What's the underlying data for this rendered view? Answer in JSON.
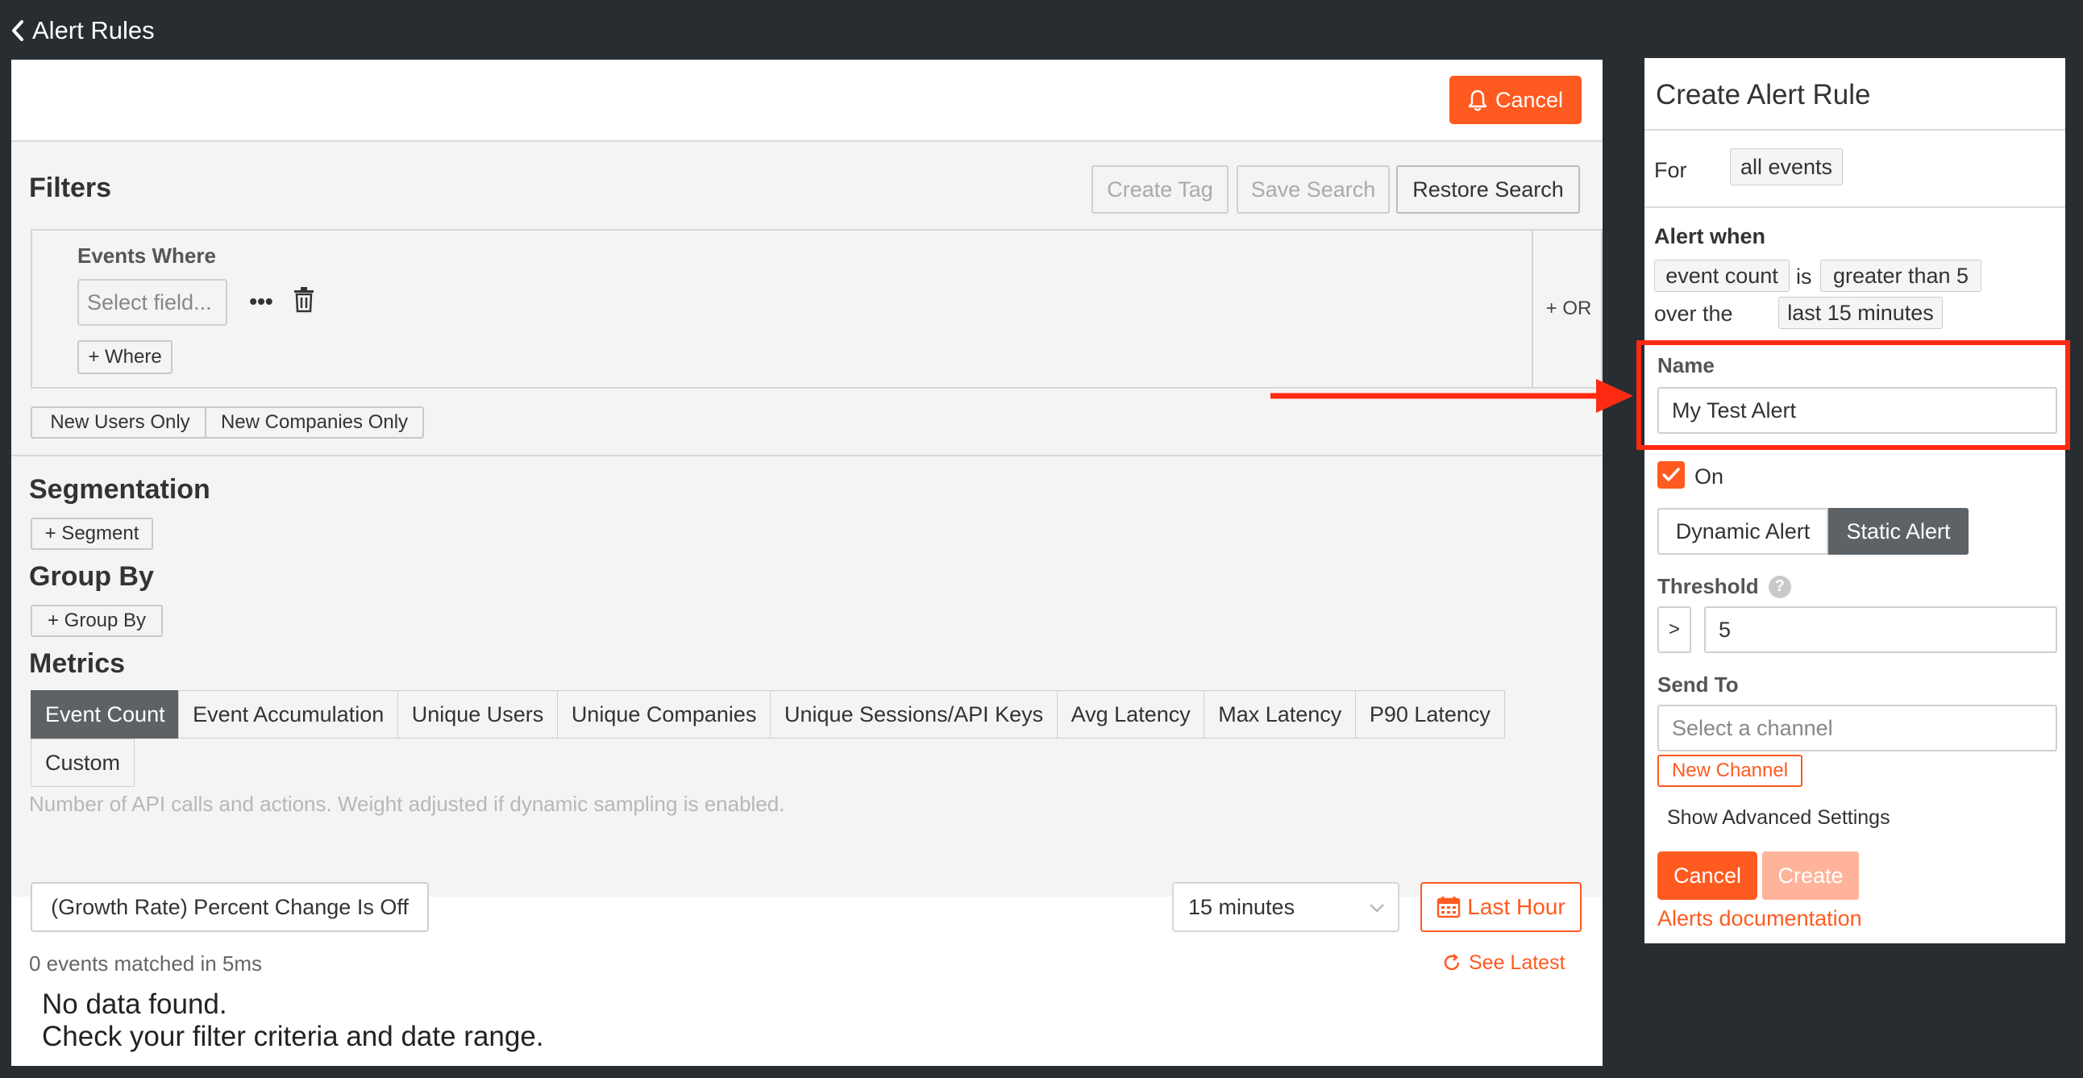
{
  "header": {
    "back_label": "Alert Rules"
  },
  "toolbar": {
    "cancel_label": "Cancel"
  },
  "filters": {
    "title": "Filters",
    "create_tag": "Create Tag",
    "save_search": "Save Search",
    "restore_search": "Restore Search",
    "events_where": "Events Where",
    "select_field_placeholder": "Select field...",
    "more": "•••",
    "add_where": "+ Where",
    "add_or": "+ OR",
    "new_users_only": "New Users Only",
    "new_companies_only": "New Companies Only"
  },
  "segmentation": {
    "title": "Segmentation",
    "add_label": "+ Segment"
  },
  "group_by": {
    "title": "Group By",
    "add_label": "+ Group By"
  },
  "metrics": {
    "title": "Metrics",
    "items": [
      "Event Count",
      "Event Accumulation",
      "Unique Users",
      "Unique Companies",
      "Unique Sessions/API Keys",
      "Avg Latency",
      "Max Latency",
      "P90 Latency",
      "Custom"
    ],
    "selected": "Event Count",
    "description": "Number of API calls and actions. Weight adjusted if dynamic sampling is enabled."
  },
  "results": {
    "growth_rate": "(Growth Rate) Percent Change Is Off",
    "interval": "15 minutes",
    "time_range": "Last Hour",
    "events_matched": "0 events matched in 5ms",
    "see_latest": "See Latest",
    "no_data_line1": "No data found.",
    "no_data_line2": "Check your filter criteria and date range."
  },
  "alert_panel": {
    "title": "Create Alert Rule",
    "for_label": "For",
    "for_value": "all events",
    "alert_when_label": "Alert when",
    "metric_value": "event count",
    "is_label": "is",
    "condition_value": "greater than 5",
    "over_label": "over the",
    "window_value": "last 15 minutes",
    "name_label": "Name",
    "name_value": "My Test Alert",
    "enabled_label": "On",
    "enabled": true,
    "alert_types": [
      "Dynamic Alert",
      "Static Alert"
    ],
    "selected_alert_type": "Static Alert",
    "threshold_label": "Threshold",
    "threshold_operator": ">",
    "threshold_value": "5",
    "send_to_label": "Send To",
    "channel_placeholder": "Select a channel",
    "new_channel": "New Channel",
    "advanced_settings": "Show Advanced Settings",
    "cancel_label": "Cancel",
    "create_label": "Create",
    "docs_link": "Alerts documentation"
  },
  "colors": {
    "accent": "#ff5a1f",
    "highlight": "#ff2a12",
    "background": "#272d31",
    "selected": "#5c6266"
  }
}
